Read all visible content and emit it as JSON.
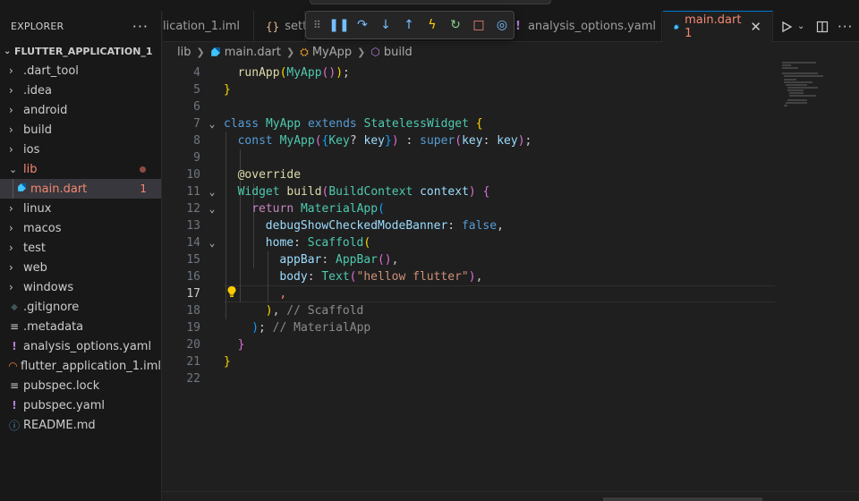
{
  "explorer": {
    "title": "EXPLORER",
    "more": "···",
    "root": "FLUTTER_APPLICATION_1",
    "items": [
      {
        "label": ".dart_tool",
        "kind": "folder"
      },
      {
        "label": ".idea",
        "kind": "folder"
      },
      {
        "label": "android",
        "kind": "folder"
      },
      {
        "label": "build",
        "kind": "folder"
      },
      {
        "label": "ios",
        "kind": "folder"
      },
      {
        "label": "lib",
        "kind": "folder-open"
      },
      {
        "label": "main.dart",
        "kind": "dart",
        "badge": "1"
      },
      {
        "label": "linux",
        "kind": "folder"
      },
      {
        "label": "macos",
        "kind": "folder"
      },
      {
        "label": "test",
        "kind": "folder"
      },
      {
        "label": "web",
        "kind": "folder"
      },
      {
        "label": "windows",
        "kind": "folder"
      },
      {
        "label": ".gitignore",
        "kind": "git"
      },
      {
        "label": ".metadata",
        "kind": "text"
      },
      {
        "label": "analysis_options.yaml",
        "kind": "yaml"
      },
      {
        "label": "flutter_application_1.iml",
        "kind": "rss"
      },
      {
        "label": "pubspec.lock",
        "kind": "text"
      },
      {
        "label": "pubspec.yaml",
        "kind": "yaml"
      },
      {
        "label": "README.md",
        "kind": "info"
      }
    ]
  },
  "tabs": [
    {
      "label": "lication_1.iml"
    },
    {
      "label": "setti"
    },
    {
      "label": "analysis_options.yaml"
    },
    {
      "label": "main.dart 1",
      "active": true
    }
  ],
  "breadcrumb": [
    "lib",
    "main.dart",
    "MyApp",
    "build"
  ],
  "editor": {
    "lines": [
      {
        "n": "4",
        "fold": "",
        "indent": 1,
        "html": "<span class='fn'>runApp</span><span class='b1'>(</span><span class='ty'>MyApp</span><span class='b2'>()</span><span class='b1'>)</span>;"
      },
      {
        "n": "5",
        "fold": "",
        "indent": 0,
        "html": "<span class='b1'>}</span>"
      },
      {
        "n": "6",
        "fold": "",
        "indent": 0,
        "html": ""
      },
      {
        "n": "7",
        "fold": "v",
        "indent": 0,
        "html": "<span class='kw'>class</span> <span class='ty'>MyApp</span> <span class='kw'>extends</span> <span class='ty'>StatelessWidget</span> <span class='b1'>{</span>"
      },
      {
        "n": "8",
        "fold": "",
        "indent": 1,
        "html": "<span class='kw'>const</span> <span class='ty'>MyApp</span><span class='b2'>(</span><span class='b3'>{</span><span class='ty'>Key</span>? <span class='pa'>key</span><span class='b3'>}</span><span class='b2'>)</span> : <span class='kw'>super</span><span class='b2'>(</span><span class='pa'>key</span>: <span class='pa'>key</span><span class='b2'>)</span>;"
      },
      {
        "n": "9",
        "fold": "",
        "indent": 0,
        "html": ""
      },
      {
        "n": "10",
        "fold": "",
        "indent": 1,
        "html": "<span class='ann'>@override</span>"
      },
      {
        "n": "11",
        "fold": "v",
        "indent": 1,
        "html": "<span class='ty'>Widget</span> <span class='fn'>build</span><span class='b2'>(</span><span class='ty'>BuildContext</span> <span class='pa'>context</span><span class='b2'>)</span> <span class='b2'>{</span>"
      },
      {
        "n": "12",
        "fold": "v",
        "indent": 2,
        "html": "<span class='ctrl'>return</span> <span class='ty'>MaterialApp</span><span class='b3'>(</span>"
      },
      {
        "n": "13",
        "fold": "",
        "indent": 3,
        "html": "<span class='pa'>debugShowCheckedModeBanner</span>: <span class='kw'>false</span>,"
      },
      {
        "n": "14",
        "fold": "v",
        "indent": 3,
        "html": "<span class='pa'>home</span>: <span class='ty'>Scaffold</span><span class='b1'>(</span>"
      },
      {
        "n": "15",
        "fold": "",
        "indent": 4,
        "html": "<span class='pa'>appBar</span>: <span class='ty'>AppBar</span><span class='b2'>()</span>,"
      },
      {
        "n": "16",
        "fold": "",
        "indent": 4,
        "html": "<span class='pa'>body</span>: <span class='ty'>Text</span><span class='b2'>(</span><span class='st'>\"hellow flutter\"</span><span class='b2'>)</span>,"
      },
      {
        "n": "17",
        "fold": "",
        "indent": 4,
        "html": "<span class='err'>,</span>",
        "current": true
      },
      {
        "n": "18",
        "fold": "",
        "indent": 3,
        "html": "<span class='b1'>)</span>, <span class='cmg'>// Scaffold</span>"
      },
      {
        "n": "19",
        "fold": "",
        "indent": 2,
        "html": "<span class='b3'>)</span>; <span class='cmg'>// MaterialApp</span>"
      },
      {
        "n": "20",
        "fold": "",
        "indent": 1,
        "html": "<span class='b2'>}</span>"
      },
      {
        "n": "21",
        "fold": "",
        "indent": 0,
        "html": "<span class='b1'>}</span>"
      },
      {
        "n": "22",
        "fold": "",
        "indent": 0,
        "html": ""
      }
    ]
  },
  "colors": {
    "accent": "#0078d4",
    "error": "#f48771",
    "folder_open_dot": "#8c4b46"
  }
}
